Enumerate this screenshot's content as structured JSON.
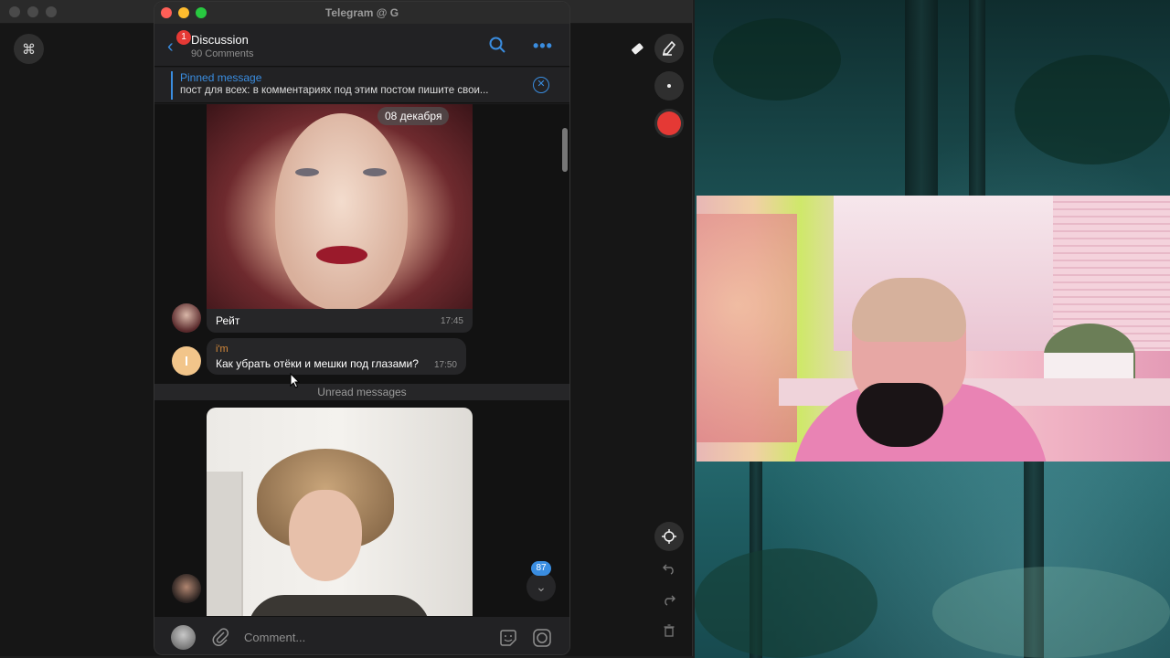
{
  "telegram": {
    "window_title": "Telegram @ G",
    "header": {
      "title": "Discussion",
      "subtitle": "90 Comments",
      "back_badge": "1"
    },
    "pinned": {
      "label": "Pinned message",
      "text": "пост для всех:   в комментариях под этим постом пишите свои..."
    },
    "messages": [
      {
        "type": "photo",
        "date_pill": "08 декабря",
        "caption": "Рейт",
        "time": "17:45"
      },
      {
        "type": "text",
        "author": "i'm",
        "text": "Как убрать отёки и мешки под глазами?",
        "time": "17:50"
      },
      {
        "type": "photo"
      }
    ],
    "unread_label": "Unread messages",
    "scroll_down_count": "87",
    "composer": {
      "placeholder": "Comment..."
    }
  },
  "desktop": {
    "cmd_key": "⌘"
  },
  "colors": {
    "accent": "#3a8de0",
    "badge": "#e53935",
    "record": "#e53935",
    "author_orange": "#d88b3b",
    "traffic_red": "#ff5f57",
    "traffic_yellow": "#febc2e",
    "traffic_green": "#28c840"
  },
  "icons": [
    "command-icon",
    "eraser-icon",
    "highlighter-icon",
    "dot-icon",
    "record-icon",
    "crosshair-icon",
    "undo-icon",
    "redo-icon",
    "trash-icon",
    "back-icon",
    "search-icon",
    "more-icon",
    "close-icon",
    "chevron-down-icon",
    "attach-icon",
    "sticker-icon",
    "camera-icon"
  ]
}
